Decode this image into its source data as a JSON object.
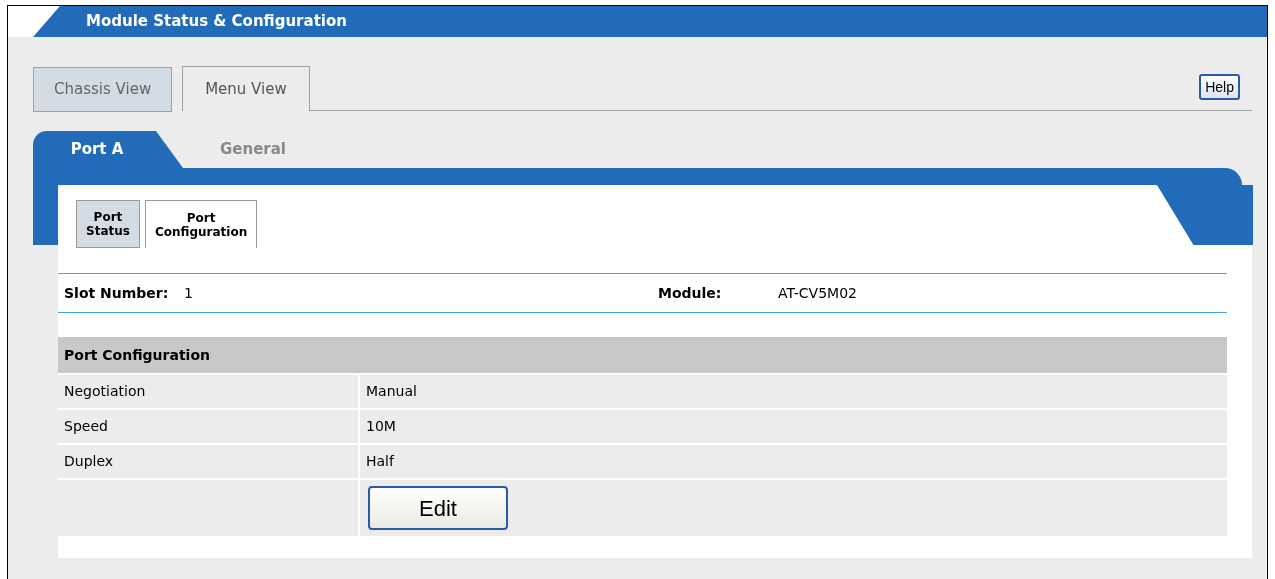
{
  "header": {
    "title": "Module Status & Configuration"
  },
  "view_tabs": [
    {
      "label": "Chassis View",
      "selected": false
    },
    {
      "label": "Menu View",
      "selected": true
    }
  ],
  "help_button": "Help",
  "port_tabs": [
    {
      "label": "Port A",
      "selected": true
    },
    {
      "label": "General",
      "selected": false
    }
  ],
  "sub_tabs": [
    {
      "label": "Port Status",
      "selected": false
    },
    {
      "label": "Port Configuration",
      "selected": true
    }
  ],
  "info": [
    {
      "label": "Slot Number:",
      "value": "1"
    },
    {
      "label": "Module:",
      "value": "AT-CV5M02"
    }
  ],
  "table": {
    "title": "Port Configuration",
    "rows": [
      {
        "label": "Negotiation",
        "value": "Manual"
      },
      {
        "label": "Speed",
        "value": "10M"
      },
      {
        "label": "Duplex",
        "value": "Half"
      }
    ],
    "button": "Edit"
  }
}
